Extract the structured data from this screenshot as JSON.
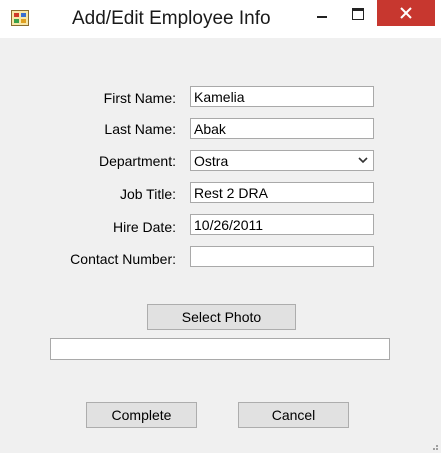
{
  "window": {
    "title": "Add/Edit Employee Info",
    "icon": "app-icon",
    "controls": [
      "minimize-icon",
      "maximize-icon",
      "close-icon"
    ],
    "colors": {
      "close_button": "#c7372f",
      "client_bg": "#f0f0f0",
      "titlebar_bg": "#ffffff"
    }
  },
  "form": {
    "first_name": {
      "label": "First Name:",
      "value": "Kamelia"
    },
    "last_name": {
      "label": "Last Name:",
      "value": "Abak"
    },
    "department": {
      "label": "Department:",
      "value": "Ostra"
    },
    "job_title": {
      "label": "Job Title:",
      "value": "Rest 2 DRA"
    },
    "hire_date": {
      "label": "Hire Date:",
      "value": "10/26/2011"
    },
    "contact_number": {
      "label": "Contact Number:",
      "value": ""
    }
  },
  "photo": {
    "button_label": "Select Photo",
    "path_value": ""
  },
  "actions": {
    "complete_label": "Complete",
    "cancel_label": "Cancel"
  }
}
